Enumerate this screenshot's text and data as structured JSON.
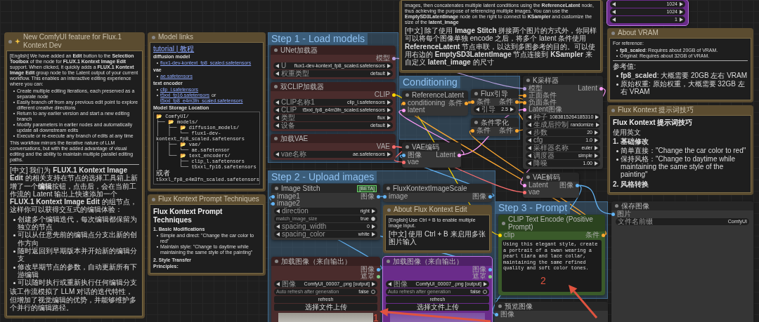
{
  "groups": [
    {
      "title": "Step 1 - Load models"
    },
    {
      "title": "Conditioning"
    },
    {
      "title": "Step 2 - Upload images"
    },
    {
      "title": "Step 3 - Prompt"
    }
  ],
  "notes": [
    {
      "title": "New ComfyUI feature for Flux.1 Kontext Dev",
      "divider": true,
      "en": [
        {
          "kind": "p",
          "text": "[English] We have added an **Edit** button to the **Selection Toolbox** of the node for **FLUX.1 Kontext Image Edit** support. When clicked, it quickly adds a **FLUX.1 Kontext Image Edit** group node to the Latent output of your current workflow. This enables an interactive editing experience where you can:"
        },
        {
          "kind": "bullets",
          "items": [
            "Create multiple editing iterations, each preserved as a separate node",
            "Easily branch off from any previous edit point to explore different creative directions",
            "Return to any earlier version and start a new editing branch",
            "Modify parameters in earlier nodes and automatically update all downstream edits",
            "Execute or re-execute any branch of edits at any time"
          ]
        },
        {
          "kind": "p",
          "text": "This workflow mirrors the iterative nature of LLM conversations, but with the added advantage of visual editing and the ability to maintain multiple parallel editing paths."
        }
      ],
      "zh": [
        {
          "kind": "p",
          "text": "[中文] 我们为 **FLUX.1 Kontext Image Edit** 的相关支持在节点的选择工具箱上新增了一个**编辑**按钮，点击后，会在当前工作流的 Latent 输出上快速添加一个 **FLUX.1 Kontext Image Edit** 的组节点，这样你可以获得交互式的编辑体验："
        },
        {
          "kind": "bullets",
          "items": [
            "创建多个编辑迭代，每次编辑都保留为独立的节点",
            "可以从任意先前的编辑点分支出新的创作方向",
            "随时返回到早期版本并开始新的编辑分支",
            "修改早期节点的参数，自动更新所有下游编辑",
            "可以随时执行或重新执行任何编辑分支"
          ]
        },
        {
          "kind": "p",
          "text": "该工作流模拟了 LLM 对话的迭代特性，但增加了视觉编辑的优势，并能够维护多个并行的编辑路径。"
        }
      ]
    },
    {
      "title": "Model links",
      "divider": false,
      "en": [
        {
          "kind": "link",
          "text": "tutorial | 教程"
        },
        {
          "kind": "h3",
          "text": "diffusion model"
        },
        {
          "kind": "links",
          "items": [
            [
              {
                "text": "flux1-dev-kontext_fp8_scaled.safetensors",
                "link": true
              }
            ]
          ]
        },
        {
          "kind": "h3",
          "text": "vae"
        },
        {
          "kind": "links",
          "items": [
            [
              {
                "text": "ae.safetensors",
                "link": true
              }
            ]
          ]
        },
        {
          "kind": "h3",
          "text": "text encoder"
        },
        {
          "kind": "links",
          "items": [
            [
              {
                "text": "clip_l.safetensors",
                "link": true
              }
            ],
            [
              {
                "text": "t5xxl_fp16.safetensors",
                "link": true
              },
              {
                "text": "or",
                "link": false
              },
              {
                "text": "t5xxl_fp8_e4m3fn_scaled.safetensors",
                "link": true
              }
            ]
          ]
        },
        {
          "kind": "h3",
          "text": "Model Storage Location"
        },
        {
          "kind": "tree",
          "lines": [
            "📂 ComfyUI/",
            "├── 📂 models/",
            "│   ├── 📂 diffusion_models/",
            "│   │   └── flux1-dev-kontext_fp8_scaled.safetensors",
            "│   ├── 📂 vae/",
            "│   │   └── ae.safetensor",
            "│   └── 📂 text_encoders/",
            "│       ├── clip_l.safetensors",
            {
              "text": "│       └── t5xxl_fp16.safetensors",
              "conj": "或者",
              "alt": "t5xxl_fp8_e4m3fn_scaled.safetensors"
            }
          ]
        }
      ]
    },
    {
      "title": "Flux Kontext Prompt Techniques",
      "divider": false,
      "en": [
        {
          "kind": "h1",
          "text": "Flux Kontext Prompt Techniques"
        },
        {
          "kind": "h2",
          "text": "1. Basic Modifications"
        },
        {
          "kind": "bullets",
          "items": [
            "Simple and direct: \"Change the car color to red\"",
            "Maintain style: \"Change to daytime while maintaining the same style of the painting\""
          ]
        },
        {
          "kind": "h2",
          "text": "2. Style Transfer"
        },
        {
          "kind": "h3",
          "text": "Principles:"
        }
      ]
    },
    {
      "divider": false,
      "en": [
        {
          "kind": "p",
          "text": "images, then concatenates multiple latent conditions using the **ReferenceLatent** node, thus achieving the purpose of referencing multiple images. You can use the **EmptySD3LatentImage** node on the right to connect to **KSampler** and customize the size of the **latent_image**"
        }
      ],
      "zh": [
        {
          "kind": "p",
          "text": "[中文] 除了使用 **Image Stitch** 拼接两个图片的方式外，你同样可以将每个图像单独 encode 之后，将多个 latent 条件使用 **ReferenceLatent** 节点串联，以达到多图参考的目的。可以使用右边的 **EmptySD3LatentImage** 节点连接到 **KSampler** 来自定义 **latent_image** 的尺寸"
        }
      ]
    },
    {
      "title": "About VRAM",
      "divider": true,
      "en": [
        {
          "kind": "p",
          "text": "For reference:"
        },
        {
          "kind": "bullets",
          "items": [
            "**fp8_scaled**: Requires about 20GB of VRAM.",
            "Original: Requires about 32GB of VRAM."
          ]
        }
      ],
      "zh": [
        {
          "kind": "p",
          "text": "参考值:"
        },
        {
          "kind": "bullets",
          "items": [
            "**fp8_scaled**: 大概需要 20GB 左右 VRAM",
            "原始权重: 原始权重，大概需要 32GB 左右 VRAM"
          ]
        }
      ]
    },
    {
      "title": "Flux Kontext 提示词技巧",
      "divider": false,
      "zh": [
        {
          "kind": "h1",
          "text": "Flux Kontext 提示词技巧"
        },
        {
          "kind": "p",
          "text": "使用英文"
        },
        {
          "kind": "h2",
          "text": "1. 基础修改"
        },
        {
          "kind": "bullets",
          "items": [
            "简单直接：\"Change the car color to red\"",
            "保持风格：\"Change to daytime while maintaining the same style of the painting\""
          ]
        },
        {
          "kind": "h2",
          "text": "2. 风格转换"
        }
      ]
    },
    {
      "title": "About Flux Kontext Edit",
      "divider": false,
      "en": [
        {
          "kind": "p",
          "text": "[English] Use Ctrl + B to enable multiple image input."
        }
      ],
      "zh": [
        {
          "kind": "p",
          "text": "[中文] 使用 Ctrl + B 来启用多张图片输入"
        }
      ]
    }
  ],
  "nodes": [
    {
      "title": "UNet加载器",
      "color": "#4a2c2c",
      "bypassed": false,
      "outputs": [
        {
          "label": "模型",
          "color": "#b39ddb"
        }
      ],
      "widgets": [
        {
          "kind": "combo",
          "label": "U",
          "value": "flux1-dev-kontext_fp8_scaled.safetensors"
        },
        {
          "kind": "combo",
          "label": "权重类型",
          "value": "default"
        }
      ]
    },
    {
      "title": "双CLIP加载器",
      "color": "#4a2c2c",
      "bypassed": false,
      "outputs": [
        {
          "label": "CLIP",
          "color": "#ffd500"
        }
      ],
      "widgets": [
        {
          "kind": "combo",
          "label": "CLIP名称1",
          "value": "clip_l.safetensors"
        },
        {
          "kind": "combo",
          "label": "CLIP",
          "value": "t5xxl_fp8_e4m3fn_scaled.safetensors"
        },
        {
          "kind": "combo",
          "label": "类型",
          "value": "flux"
        },
        {
          "kind": "combo",
          "label": "设备",
          "value": "default"
        }
      ]
    },
    {
      "title": "加载VAE",
      "color": "#4a2c2c",
      "bypassed": false,
      "outputs": [
        {
          "label": "VAE",
          "color": "#ff6e6e"
        }
      ],
      "widgets": [
        {
          "kind": "combo",
          "label": "vae名称",
          "value": "ae.safetensors"
        }
      ]
    },
    {
      "title": "ReferenceLatent",
      "color": "#353535",
      "bypassed": false,
      "inputs": [
        {
          "label": "conditioning",
          "color": "#ffa931"
        },
        {
          "label": "latent",
          "color": "#ff9cf9"
        }
      ],
      "outputs": [
        {
          "label": "条件",
          "color": "#ffa931"
        }
      ]
    },
    {
      "title": "Flux引导",
      "color": "#353535",
      "bypassed": false,
      "inputs": [
        {
          "label": "条件",
          "color": "#ffa931"
        }
      ],
      "outputs": [
        {
          "label": "条件",
          "color": "#ffa931"
        }
      ],
      "widgets": [
        {
          "kind": "number",
          "label": "引导",
          "value": "2.5"
        }
      ]
    },
    {
      "title": "条件零化",
      "color": "#353535",
      "bypassed": false,
      "inputs": [
        {
          "label": "条件",
          "color": "#ffa931"
        }
      ],
      "outputs": [
        {
          "label": "条件",
          "color": "#ffa931"
        }
      ]
    },
    {
      "title": "VAE编码",
      "color": "#353535",
      "bypassed": false,
      "inputs": [
        {
          "label": "图像",
          "color": "#64b5f6"
        },
        {
          "label": "vae",
          "color": "#ff6e6e"
        }
      ],
      "outputs": [
        {
          "label": "Latent",
          "color": "#ff9cf9"
        }
      ]
    },
    {
      "color": "#6a2c8a",
      "bypassed": true,
      "widgets": [
        {
          "kind": "number",
          "value": "1024"
        },
        {
          "kind": "number",
          "value": "1024"
        },
        {
          "kind": "number",
          "value": "1"
        }
      ]
    },
    {
      "title": "K采样器",
      "color": "#353535",
      "bypassed": false,
      "inputs": [
        {
          "label": "模型",
          "color": "#b39ddb"
        },
        {
          "label": "正面条件",
          "color": "#ffa931"
        },
        {
          "label": "负面条件",
          "color": "#ffa931"
        },
        {
          "label": "Latent图像",
          "color": "#ff9cf9"
        }
      ],
      "outputs": [
        {
          "label": "Latent",
          "color": "#ff9cf9"
        }
      ],
      "widgets": [
        {
          "kind": "number",
          "label": "种子",
          "value": "1083815264185310"
        },
        {
          "kind": "combo",
          "label": "生成后控制",
          "value": "randomize"
        },
        {
          "kind": "number",
          "label": "步数",
          "value": "20"
        },
        {
          "kind": "number",
          "label": "cfg",
          "value": "1.0"
        },
        {
          "kind": "combo",
          "label": "采样器名称",
          "value": "euler"
        },
        {
          "kind": "combo",
          "label": "调度器",
          "value": "simple"
        },
        {
          "kind": "number",
          "label": "降噪",
          "value": "1.00"
        }
      ]
    },
    {
      "title": "VAE解码",
      "color": "#353535",
      "bypassed": false,
      "inputs": [
        {
          "label": "Latent",
          "color": "#ff9cf9"
        },
        {
          "label": "vae",
          "color": "#ff6e6e"
        }
      ],
      "outputs": [
        {
          "label": "图像",
          "color": "#64b5f6"
        }
      ]
    },
    {
      "title": "Image Stitch",
      "color": "#353535",
      "bypassed": false,
      "badge": "[BETA]",
      "inputs": [
        {
          "label": "image1",
          "color": "#64b5f6"
        },
        {
          "label": "image2",
          "color": "#64b5f6"
        }
      ],
      "outputs": [
        {
          "label": "图像",
          "color": "#64b5f6"
        }
      ],
      "widgets": [
        {
          "kind": "combo",
          "label": "direction",
          "value": "right"
        },
        {
          "kind": "toggle",
          "label": "match_image_size",
          "value": "true",
          "on": true
        },
        {
          "kind": "number",
          "label": "spacing_width",
          "value": "0"
        },
        {
          "kind": "combo",
          "label": "spacing_color",
          "value": "white"
        }
      ]
    },
    {
      "title": "FluxKontextImageScale",
      "color": "#353535",
      "bypassed": false,
      "inputs": [
        {
          "label": "image",
          "color": "#64b5f6"
        }
      ],
      "outputs": [
        {
          "label": "图像",
          "color": "#64b5f6"
        }
      ]
    },
    {
      "title": "加载图像（来自输出）",
      "color": "#4a2c2c",
      "bypassed": false,
      "photo": true,
      "outputs": [
        {
          "label": "图像",
          "color": "#64b5f6"
        },
        {
          "label": "遮罩",
          "color": "#81c784"
        }
      ],
      "widgets": [
        {
          "kind": "combo",
          "label": "图像",
          "value": "ComfyUI_00007_.png [output]"
        },
        {
          "kind": "toggle",
          "label": "Auto refresh after generation",
          "value": "false",
          "on": false
        },
        {
          "kind": "button",
          "label": "refresh"
        },
        {
          "kind": "button",
          "label": "选择文件上传"
        }
      ]
    },
    {
      "title": "加载图像（来自输出）",
      "color": "#6a2c8a",
      "bypassed": true,
      "photo": true,
      "outputs": [
        {
          "label": "图像",
          "color": "#64b5f6"
        },
        {
          "label": "遮罩",
          "color": "#81c784"
        }
      ],
      "widgets": [
        {
          "kind": "combo",
          "label": "图像",
          "value": "ComfyUI_00007_.png [output]"
        },
        {
          "kind": "toggle",
          "label": "Auto refresh after generation",
          "value": "false",
          "on": false
        },
        {
          "kind": "button",
          "label": "refresh"
        },
        {
          "kind": "button",
          "label": "选择文件上传"
        }
      ]
    },
    {
      "title": "CLIP Text Encode (Positive Prompt)",
      "color": "#3a5a2a",
      "bypassed": false,
      "inputs": [
        {
          "label": "clip",
          "color": "#ffd500"
        }
      ],
      "outputs": [
        {
          "label": "条件",
          "color": "#ffa931"
        }
      ],
      "text": "Using this elegant style, create a portrait of a swan wearing a pearl tiara and lace collar, maintaining the same refined quality and soft color tones."
    },
    {
      "title": "预览图像",
      "color": "#353535",
      "bypassed": false,
      "inputs": [
        {
          "label": "图像",
          "color": "#64b5f6"
        }
      ]
    },
    {
      "title": "保存图像",
      "color": "#353535",
      "bypassed": false,
      "inputs": [
        {
          "label": "图片",
          "color": "#64b5f6"
        }
      ],
      "widgets": [
        {
          "kind": "text",
          "label": "文件名前缀",
          "value": "ComfyUI"
        }
      ]
    }
  ],
  "annotations": [
    {
      "label": "1"
    },
    {
      "label": "2"
    }
  ]
}
